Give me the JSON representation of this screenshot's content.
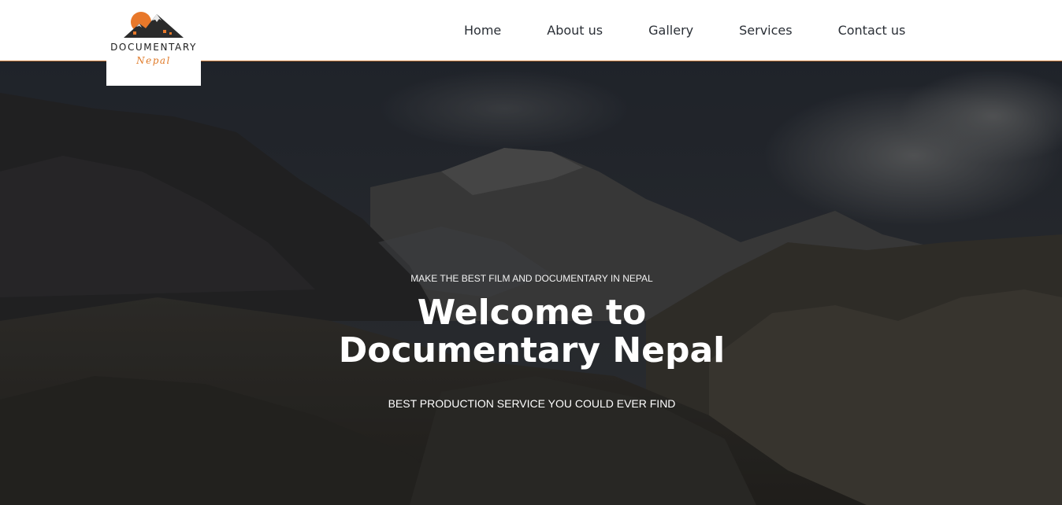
{
  "brand": {
    "name": "DOCUMENTARY",
    "subname": "Nepal",
    "accent_color": "#e07a28"
  },
  "nav": {
    "items": [
      {
        "label": "Home"
      },
      {
        "label": "About us"
      },
      {
        "label": "Gallery"
      },
      {
        "label": "Services"
      },
      {
        "label": "Contact us"
      }
    ]
  },
  "hero": {
    "kicker": "MAKE THE BEST FILM AND DOCUMENTARY IN NEPAL",
    "title": "Welcome to Documentary Nepal",
    "tagline": "BEST PRODUCTION SERVICE YOU COULD EVER FIND",
    "background": "mountain-landscape-image"
  }
}
